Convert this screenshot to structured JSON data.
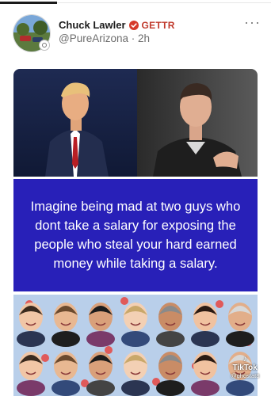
{
  "post": {
    "author_name": "Chuck Lawler",
    "platform_label": "GETTR",
    "handle": "@PureArizona",
    "separator": " · ",
    "time": "2h",
    "more_label": "···"
  },
  "image": {
    "caption": "Imagine being mad at two guys who dont take a salary for exposing the people who steal your hard earned money while taking a salary.",
    "watermark_brand": "TikTok",
    "watermark_handle": "@ghostat8"
  },
  "colors": {
    "caption_bg": "#2820b8",
    "faces_bg": "#b9cfea",
    "verified": "#d63a2a",
    "gettr": "#c0392b"
  },
  "icons": [
    "verified-icon",
    "more-options-icon",
    "tiktok-logo-icon",
    "avatar-badge-icon"
  ]
}
